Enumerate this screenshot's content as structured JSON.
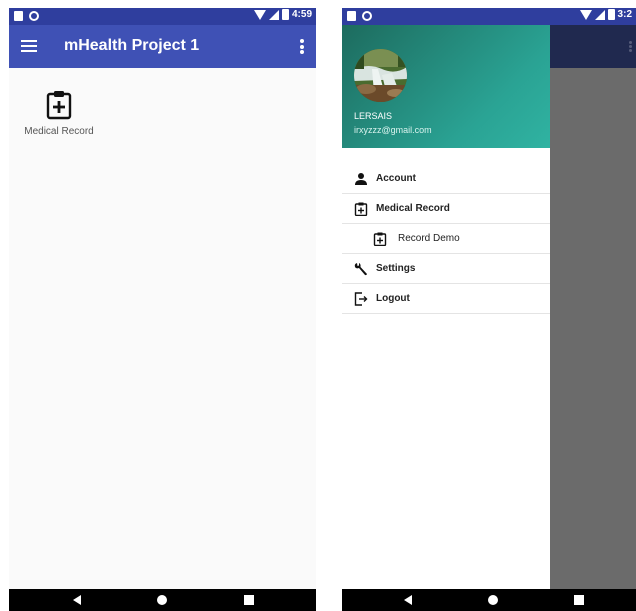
{
  "left_screen": {
    "status_bar": {
      "time": "4:59"
    },
    "app_bar": {
      "title": "mHealth Project 1"
    },
    "home": {
      "items": [
        {
          "label": "Medical Record",
          "icon": "clipboard-plus-icon"
        }
      ]
    }
  },
  "right_screen": {
    "status_bar": {
      "time": "3:2"
    },
    "drawer": {
      "user_name": "LERSAIS",
      "user_email": "irxyzzz@gmail.com",
      "menu": [
        {
          "label": "Account",
          "icon": "person-icon",
          "level": 0
        },
        {
          "label": "Medical Record",
          "icon": "clipboard-plus-icon",
          "level": 0
        },
        {
          "label": "Record Demo",
          "icon": "clipboard-plus-icon",
          "level": 1
        },
        {
          "label": "Settings",
          "icon": "wrench-icon",
          "level": 0
        },
        {
          "label": "Logout",
          "icon": "logout-icon",
          "level": 0
        }
      ]
    }
  },
  "colors": {
    "status_bar": "#2f3e9e",
    "app_bar": "#3f51b5",
    "drawer_header": "#2aa394",
    "scrim": "#6b6b6b"
  }
}
